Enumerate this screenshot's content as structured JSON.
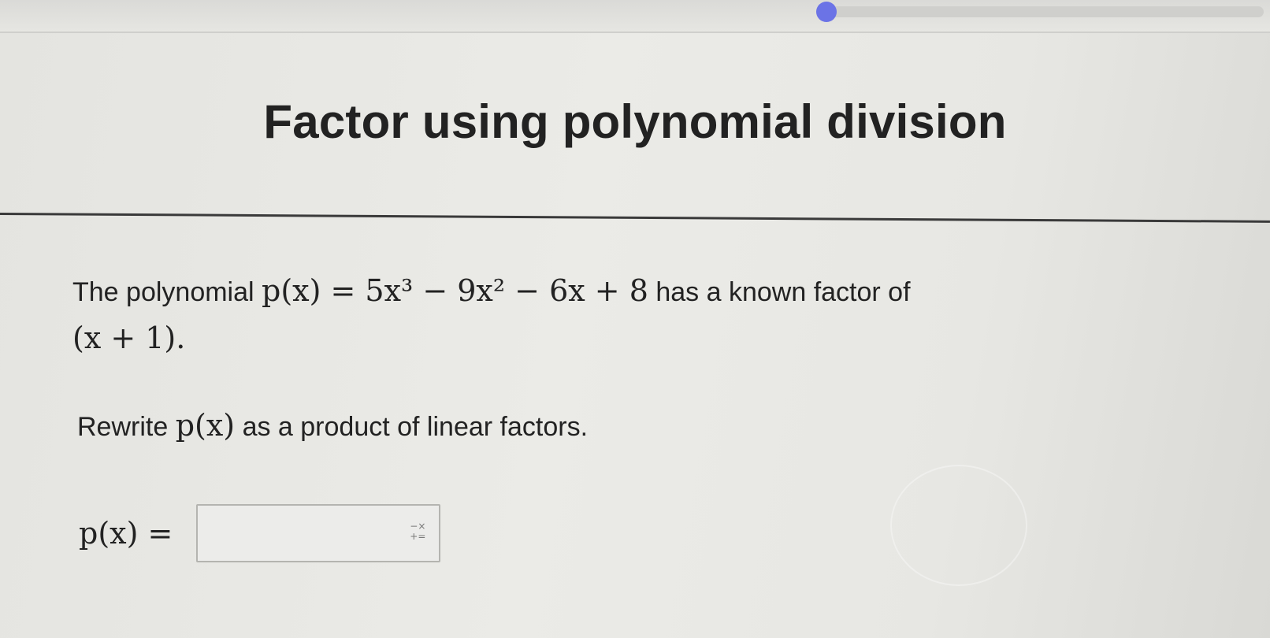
{
  "page": {
    "title": "Factor using polynomial division"
  },
  "question": {
    "intro_text": "The polynomial",
    "polynomial_expression": "p(x) = 5x³ − 9x² − 6x + 8",
    "known_factor_text": "has a known factor of",
    "factor_expression": "(x + 1)."
  },
  "instruction": {
    "prefix": "Rewrite",
    "function_name": "p(x)",
    "suffix": "as a product of linear factors."
  },
  "answer": {
    "lhs": "p(x) =",
    "value": "",
    "keypad_icon": "math-keypad-icon",
    "keypad_symbols": [
      "−×",
      "+="
    ]
  },
  "progress": {
    "accent_color": "#6b73e6"
  }
}
